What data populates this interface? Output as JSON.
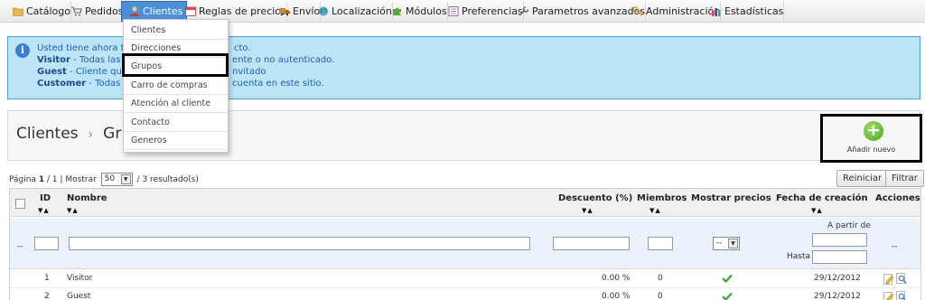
{
  "menu": {
    "items": [
      {
        "label": "Catálogo",
        "icon": "folder-icon"
      },
      {
        "label": "Pedidos",
        "icon": "cart-icon"
      },
      {
        "label": "Clientes",
        "icon": "user-icon"
      },
      {
        "label": "Reglas de precios",
        "icon": "calendar-icon"
      },
      {
        "label": "Envío",
        "icon": "truck-icon"
      },
      {
        "label": "Localización",
        "icon": "globe-icon"
      },
      {
        "label": "Módulos",
        "icon": "puzzle-icon"
      },
      {
        "label": "Preferencias",
        "icon": "notebook-icon"
      },
      {
        "label": "Parametros avanzados",
        "icon": "wrench-icon"
      },
      {
        "label": "Administración",
        "icon": "key-icon"
      },
      {
        "label": "Estadísticas",
        "icon": "bar-chart-icon"
      }
    ],
    "active": "Clientes"
  },
  "submenu": {
    "items": [
      "Clientes",
      "Direcciones",
      "Grupos",
      "Carro de compras",
      "Atención al cliente",
      "Contacto",
      "Generos"
    ],
    "highlighted": "Grupos"
  },
  "info": {
    "line1_start": "Usted tiene ahora tres",
    "line1_end": "cto.",
    "line2_name": "Visitor",
    "line2_start": " - Todas las pe",
    "line2_end": "ente o no autenticado.",
    "line3_name": "Guest",
    "line3_start": " - Cliente que h",
    "line3_end": "nvitado",
    "line4_name": "Customer",
    "line4_start": " - Todas las",
    "line4_end": "cuenta en este sitio."
  },
  "header": {
    "crumb_root": "Clientes",
    "crumb_sep": "›",
    "crumb_current": "Gr",
    "add_new_label": "Añadir nuevo"
  },
  "pagination": {
    "page_label": "Página",
    "current_page": "1",
    "total_pages": "1",
    "show_label": "Mostrar",
    "per_page": "50",
    "results": "3 resultado(s)"
  },
  "buttons": {
    "reset": "Reiniciar",
    "filter": "Filtrar"
  },
  "table": {
    "columns": [
      "ID",
      "Nombre",
      "Descuento (%)",
      "Miembros",
      "Mostrar precios",
      "Fecha de creación",
      "Acciones"
    ],
    "filter": {
      "dash": "--",
      "select_value": "--",
      "from_label": "A partir de",
      "to_label": "Hasta"
    },
    "rows": [
      {
        "id": "1",
        "name": "Visitor",
        "discount": "0.00 %",
        "members": "0",
        "show_prices": true,
        "date": "29/12/2012"
      },
      {
        "id": "2",
        "name": "Guest",
        "discount": "0.00 %",
        "members": "0",
        "show_prices": true,
        "date": "29/12/2012"
      }
    ]
  },
  "colors": {
    "active_tab": "#4c8fd6",
    "info_bg": "#bde5f8",
    "info_text": "#1f5fae",
    "check_green": "#3aa23a",
    "add_green": "#4ca21a"
  }
}
